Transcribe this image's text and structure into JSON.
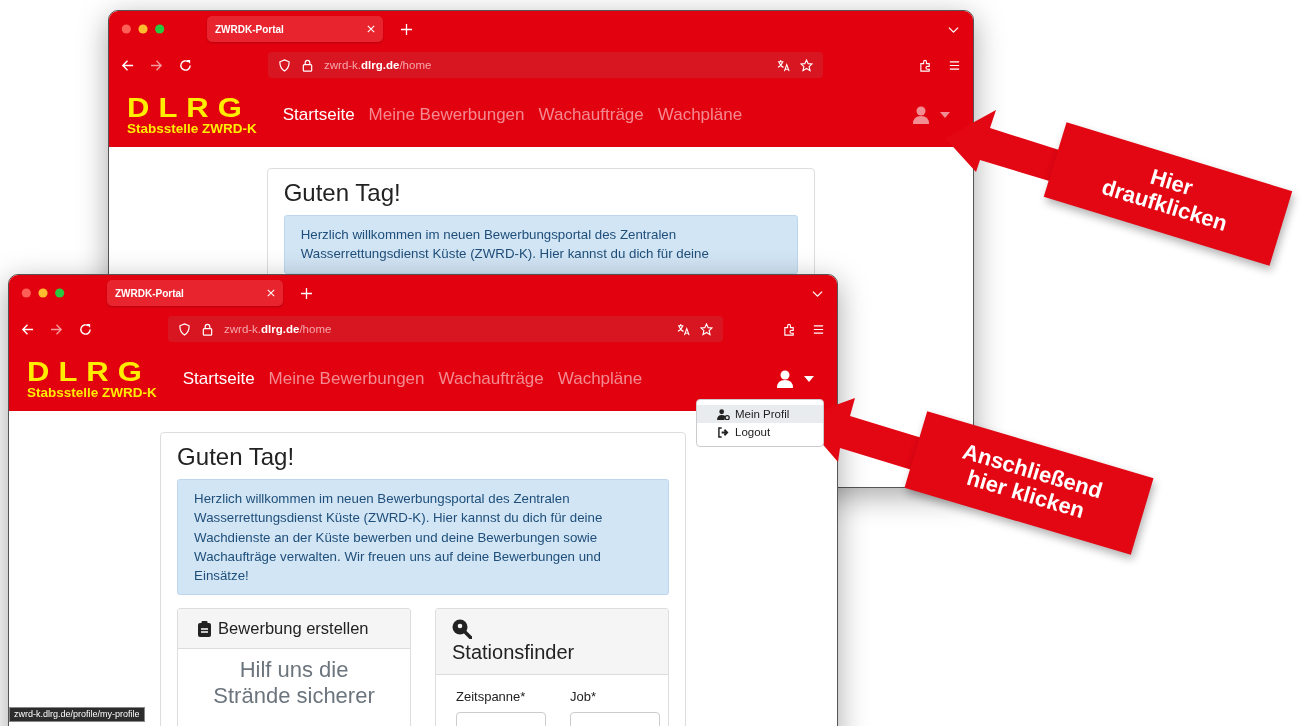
{
  "windows": [
    {
      "tab": {
        "title": "ZWRDK-Portal"
      },
      "url": "zwrd-k.**dlrg.de**/home",
      "logo": {
        "wordmark": "DLRG",
        "subtitle": "Stabsstelle ZWRD-K"
      },
      "nav": [
        {
          "label": "Startseite",
          "selected": true
        },
        {
          "label": "Meine Bewerbungen",
          "selected": false
        },
        {
          "label": "Wachaufträge",
          "selected": false
        },
        {
          "label": "Wachpläne",
          "selected": false
        }
      ],
      "user_menu": {
        "expanded": false
      },
      "content": {
        "heading": "Guten Tag!",
        "alert": "Herzlich willkommen im neuen Bewerbungsportal des Zentralen Wasserrettungsdienst Küste (ZWRD-K). Hier kannst du dich für deine"
      }
    },
    {
      "tab": {
        "title": "ZWRDK-Portal"
      },
      "url": "zwrd-k.**dlrg.de**/home",
      "logo": {
        "wordmark": "DLRG",
        "subtitle": "Stabsstelle ZWRD-K"
      },
      "nav": [
        {
          "label": "Startseite",
          "selected": true
        },
        {
          "label": "Meine Bewerbungen",
          "selected": false
        },
        {
          "label": "Wachaufträge",
          "selected": false
        },
        {
          "label": "Wachpläne",
          "selected": false
        }
      ],
      "user_menu": {
        "expanded": true,
        "items": [
          {
            "kind": "profile",
            "label": "Mein Profil",
            "selected": true
          },
          {
            "kind": "logout",
            "label": "Logout",
            "selected": false
          }
        ]
      },
      "content": {
        "heading": "Guten Tag!",
        "alert": "Herzlich willkommen im neuen Bewerbungsportal des Zentralen Wasserrettungsdienst Küste (ZWRD-K). Hier kannst du dich für deine Wachdienste an der Küste bewerben und deine Bewerbungen sowie Wachaufträge verwalten. Wir freuen uns auf deine Bewerbungen und Einsätze!",
        "cards": [
          {
            "kind": "application",
            "title": "Bewerbung erstellen",
            "body": "Hilf uns die Strände sicherer"
          },
          {
            "kind": "station_finder",
            "title": "Stationsfinder",
            "fields": [
              {
                "label": "Zeitspanne*"
              },
              {
                "label": "Job*"
              }
            ]
          }
        ]
      },
      "status_url": "zwrd-k.dlrg.de/profile/my-profile"
    }
  ],
  "annotations": [
    {
      "text": "Hier draufklicken"
    },
    {
      "text": "Anschließend hier klicken"
    }
  ]
}
